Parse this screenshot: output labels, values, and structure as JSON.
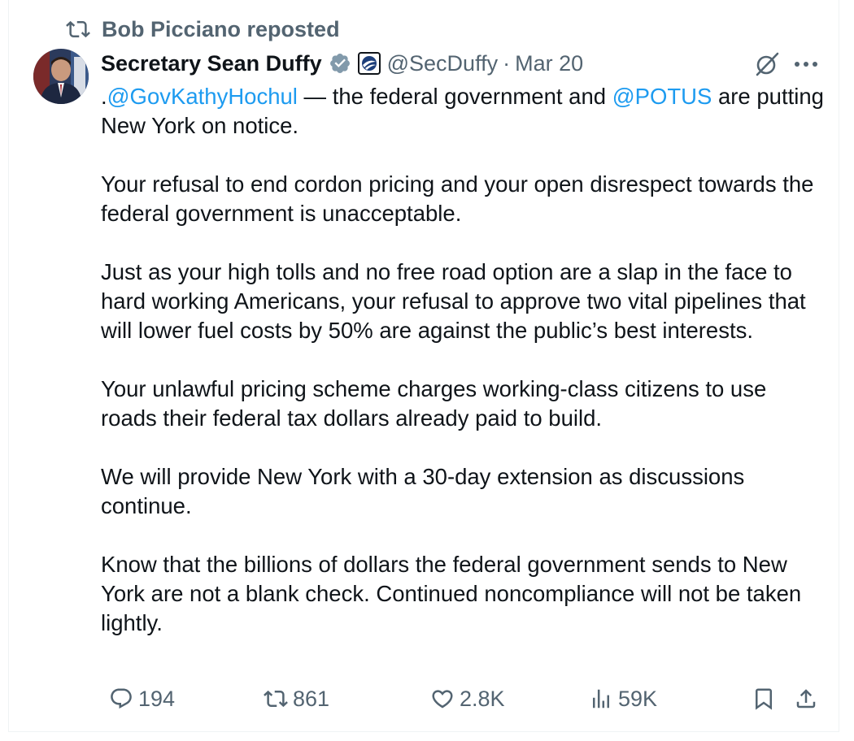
{
  "repost_banner": {
    "text": "Bob Picciano reposted",
    "icon": "repost-icon"
  },
  "author": {
    "display_name": "Secretary Sean Duffy",
    "handle": "@SecDuffy",
    "separator": "·",
    "date": "Mar 20",
    "verified_badge": "gray-verified-badge",
    "affiliation_icon": "dot-logo-icon"
  },
  "tweet": {
    "p1": {
      "lead": ".",
      "mention1": "@GovKathyHochul",
      "mid": " — the federal government and ",
      "mention2": "@POTUS",
      "tail": " are putting New York on notice."
    },
    "p2": "Your refusal to end cordon pricing and your open disrespect towards the federal government is unacceptable.",
    "p3": "Just as your high tolls and no free road option are a slap in the face to hard working Americans, your refusal to approve two vital pipelines that will lower fuel costs by 50% are against the public’s best interests.",
    "p4": "Your unlawful pricing scheme charges working-class citizens to use roads their federal tax dollars already paid to build.",
    "p5": "We will provide New York with a 30-day extension as discussions continue.",
    "p6": "Know that the billions of dollars the federal government sends to New York are not a blank check. Continued noncompliance will not be taken lightly."
  },
  "actions": {
    "replies": "194",
    "reposts": "861",
    "likes": "2.8K",
    "views": "59K"
  },
  "colors": {
    "text": "#0f1419",
    "secondary": "#536471",
    "link": "#1d9bf0",
    "border": "#eff3f4"
  }
}
